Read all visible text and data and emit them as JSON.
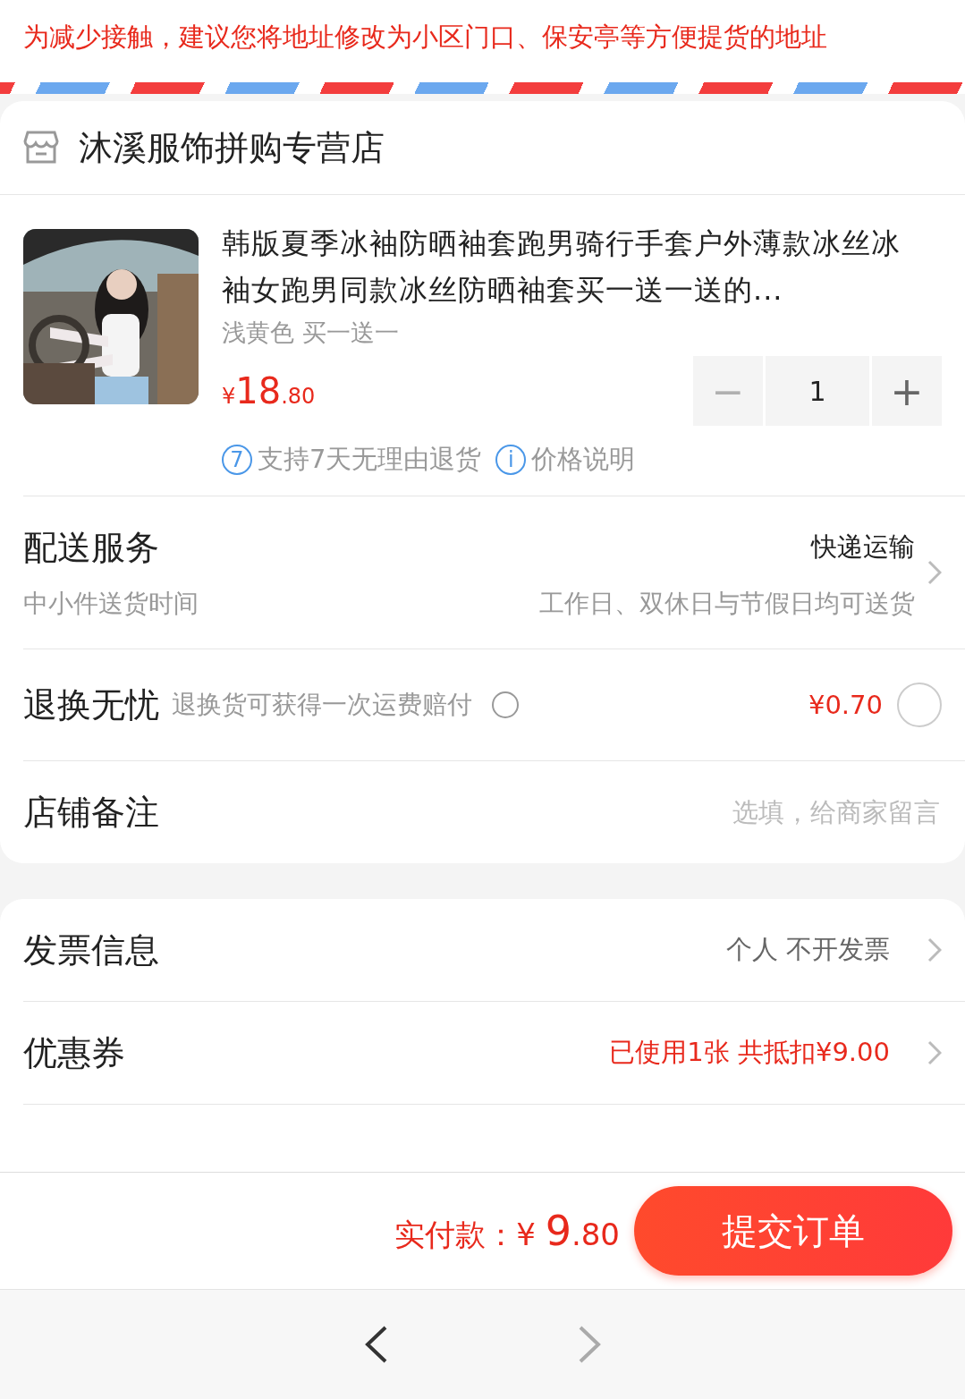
{
  "notice": "为减少接触，建议您将地址修改为小区门口、保安亭等方便提货的地址",
  "store": {
    "name": "沐溪服饰拼购专营店"
  },
  "product": {
    "title": "韩版夏季冰袖防晒袖套跑男骑行手套户外薄款冰丝冰袖女跑男同款冰丝防晒袖套买一送一送的...",
    "variant": "浅黄色 买一送一",
    "price": {
      "symbol": "¥",
      "main": "18",
      "fraction": ".80"
    },
    "quantity": {
      "minus": "−",
      "value": "1",
      "plus": "+",
      "minus_disabled": true
    },
    "badges": [
      {
        "icon": "7",
        "label": "支持7天无理由退货"
      },
      {
        "icon": "i",
        "label": "价格说明"
      }
    ]
  },
  "store_rows": [
    {
      "kind": "delivery",
      "title": "配送服务",
      "subtitle": "中小件送货时间",
      "value": "快递运输",
      "detail": "工作日、双休日与节假日均可送货"
    },
    {
      "kind": "toggle",
      "title": "退换无忧",
      "note": "退换货可获得一次运费赔付",
      "value": "¥0.70",
      "checked": false
    },
    {
      "kind": "input",
      "title": "店铺备注",
      "placeholder": "选填，给商家留言"
    }
  ],
  "order_rows": [
    {
      "title": "发票信息",
      "value": "个人 不开发票",
      "highlight": false
    },
    {
      "title": "优惠券",
      "value": "已使用1张 共抵扣¥9.00",
      "highlight": true
    }
  ],
  "footer": {
    "label": "实付款：",
    "symbol": "¥",
    "main": "9",
    "fraction": ".80",
    "submit": "提交订单"
  }
}
